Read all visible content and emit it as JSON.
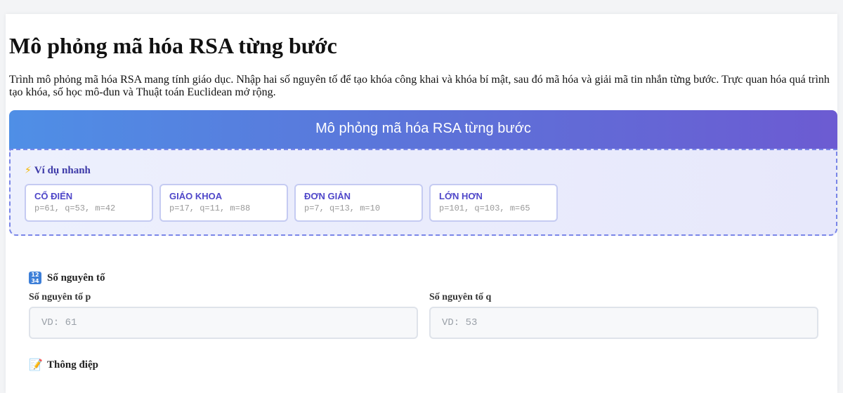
{
  "page": {
    "title": "Mô phỏng mã hóa RSA từng bước",
    "description": "Trình mô phỏng mã hóa RSA mang tính giáo dục. Nhập hai số nguyên tố để tạo khóa công khai và khóa bí mật, sau đó mã hóa và giải mã tin nhắn từng bước. Trực quan hóa quá trình tạo khóa, số học mô-đun và Thuật toán Euclidean mở rộng."
  },
  "app": {
    "header_title": "Mô phỏng mã hóa RSA từng bước",
    "header_gradient": [
      "#4f8fe6",
      "#6c5bd2"
    ]
  },
  "quick_examples": {
    "icon": "lightning-icon",
    "title": "Ví dụ nhanh",
    "items": [
      {
        "name": "CỔ ĐIỂN",
        "params": "p=61, q=53, m=42"
      },
      {
        "name": "GIÁO KHOA",
        "params": "p=17, q=11, m=88"
      },
      {
        "name": "ĐƠN GIẢN",
        "params": "p=7, q=13, m=10"
      },
      {
        "name": "LỚN HƠN",
        "params": "p=101, q=103, m=65"
      }
    ]
  },
  "primes": {
    "icon": "numbers-icon",
    "title": "Số nguyên tố",
    "p_label": "Số nguyên tố p",
    "p_placeholder": "VD: 61",
    "q_label": "Số nguyên tố q",
    "q_placeholder": "VD: 53"
  },
  "message": {
    "icon": "memo-icon",
    "title": "Thông điệp"
  }
}
